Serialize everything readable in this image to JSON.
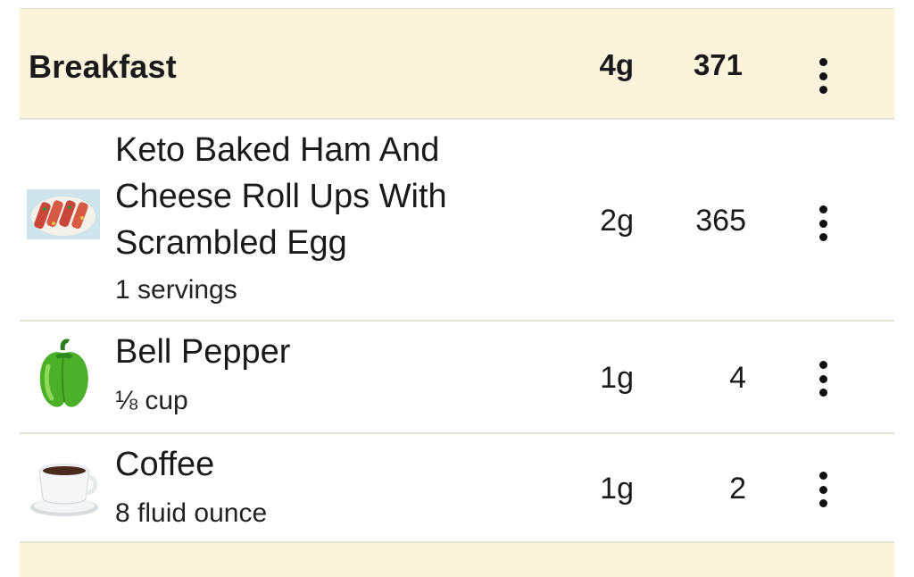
{
  "meal": {
    "title": "Breakfast",
    "net_carbs": "4g",
    "calories": "371"
  },
  "items": [
    {
      "icon": "ham-roll-ups-photo",
      "name": "Keto Baked Ham And Cheese Roll Ups With Scrambled Egg",
      "name_lines": [
        "Keto Baked Ham And",
        "Cheese Roll Ups With",
        "Scrambled Egg"
      ],
      "serving": "1 servings",
      "net_carbs": "2g",
      "calories": "365"
    },
    {
      "icon": "bell-pepper-icon",
      "name": "Bell Pepper",
      "serving": "⅛ cup",
      "net_carbs": "1g",
      "calories": "4"
    },
    {
      "icon": "coffee-cup-icon",
      "name": "Coffee",
      "serving": "8 fluid ounce",
      "net_carbs": "1g",
      "calories": "2"
    }
  ],
  "colors": {
    "header_bg": "#fcf3dc",
    "divider": "#e5e1d6",
    "text": "#1a1a1a"
  }
}
